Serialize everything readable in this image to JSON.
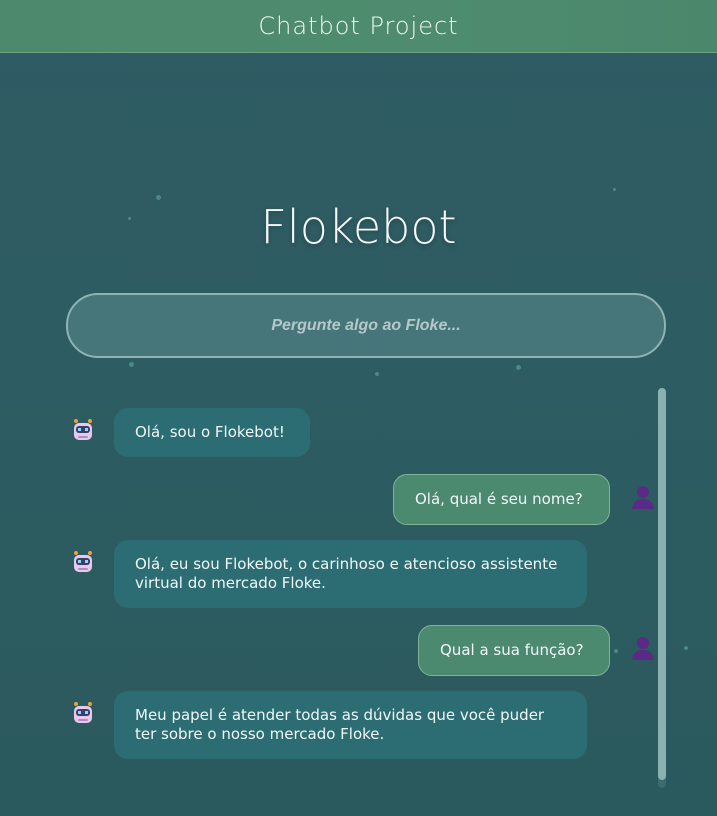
{
  "header": {
    "title": "Chatbot Project"
  },
  "bot": {
    "name": "Flokebot"
  },
  "search": {
    "placeholder": "Pergunte algo ao Floke..."
  },
  "messages": [
    {
      "sender": "bot",
      "text": "Olá, sou o Flokebot!"
    },
    {
      "sender": "user",
      "text": "Olá, qual é seu nome?"
    },
    {
      "sender": "bot",
      "text": "Olá, eu sou Flokebot, o carinhoso e atencioso assistente virtual do mercado Floke."
    },
    {
      "sender": "user",
      "text": "Qual a sua função?"
    },
    {
      "sender": "bot",
      "text": "Meu papel é atender todas as dúvidas que você puder ter sobre o nosso mercado Floke."
    }
  ],
  "colors": {
    "header": "#4f8c6f",
    "background": "#2d5c62",
    "bot_bubble": "#2b6d72",
    "user_bubble": "#4c8a70",
    "user_icon": "#5a2a86"
  },
  "icons": {
    "bot_avatar": "robot-icon",
    "user_avatar": "user-icon"
  }
}
